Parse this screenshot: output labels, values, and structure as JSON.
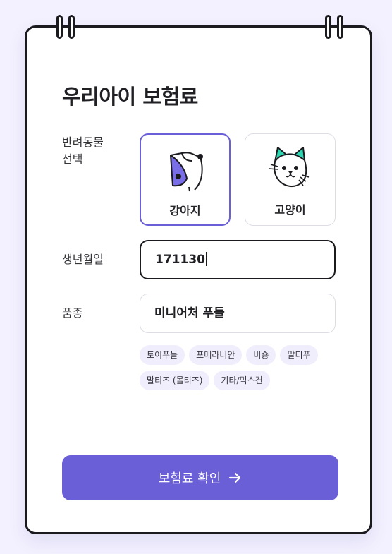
{
  "page": {
    "title": "우리아이 보험료"
  },
  "pet_select": {
    "label": "반려동물\n선택",
    "options": [
      {
        "label": "강아지",
        "icon": "dog-icon",
        "selected": true
      },
      {
        "label": "고양이",
        "icon": "cat-icon",
        "selected": false
      }
    ]
  },
  "birth": {
    "label": "생년월일",
    "value": "171130"
  },
  "breed": {
    "label": "품종",
    "value": "미니어처 푸들",
    "suggestions": [
      "토이푸들",
      "포메라니안",
      "비숑",
      "말티푸",
      "말티즈 (몰티즈)",
      "기타/믹스견"
    ]
  },
  "submit": {
    "label": "보험료 확인",
    "icon": "arrow-right-icon"
  },
  "colors": {
    "accent": "#6b5fd8",
    "background": "#f3f1ff",
    "chip_bg": "#f0eefd",
    "cat_ears": "#2fd5b0",
    "border_dark": "#1b1b1f"
  }
}
